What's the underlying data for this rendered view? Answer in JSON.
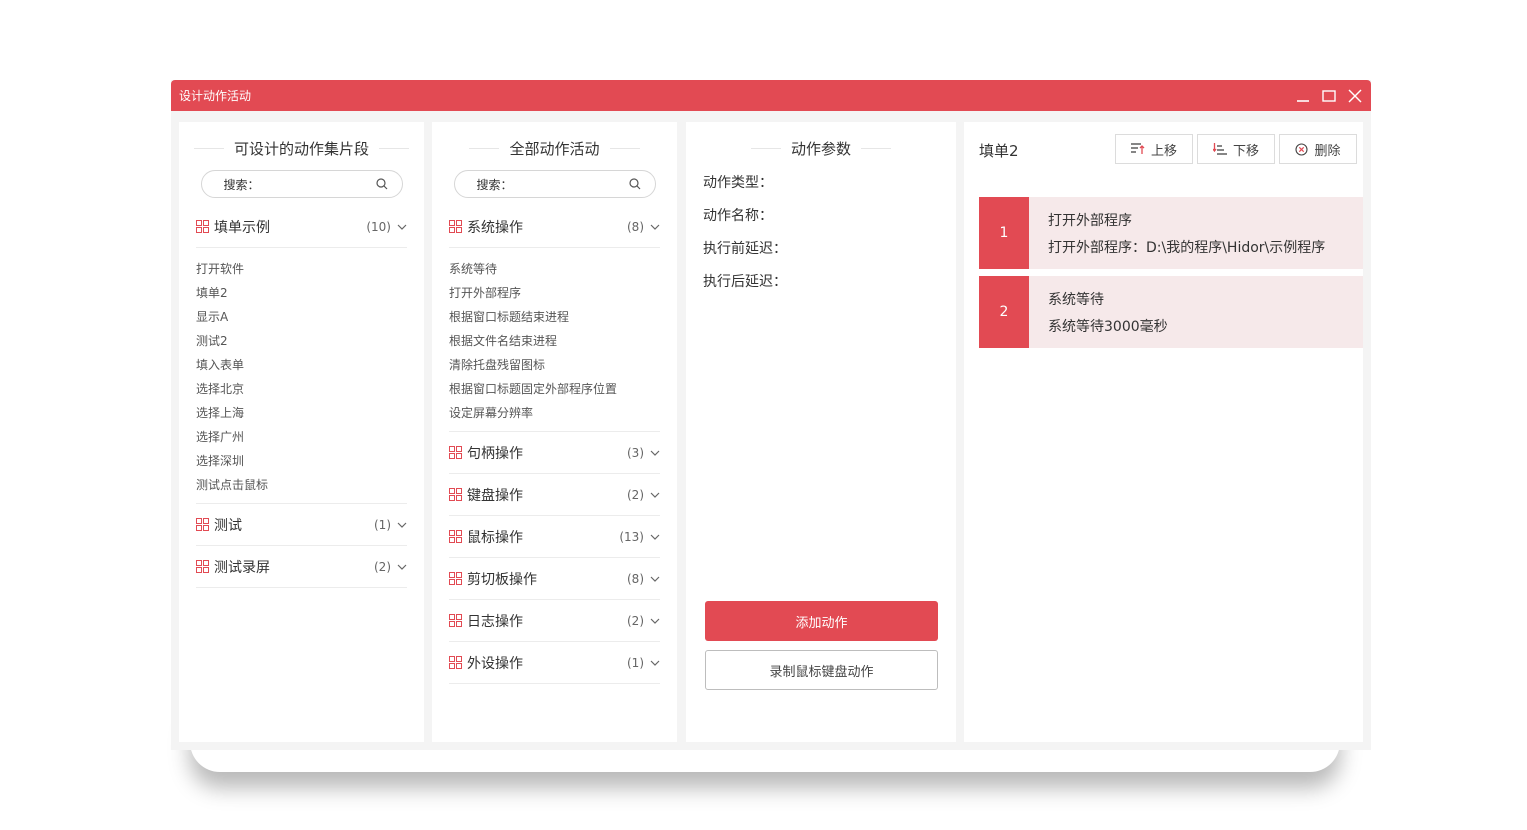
{
  "window": {
    "title": "设计动作活动",
    "accent": "#e24a53"
  },
  "panel1": {
    "header": "可设计的动作集片段",
    "search_label": "搜索：",
    "groups": [
      {
        "name": "填单示例",
        "count": "(10)",
        "items": [
          "打开软件",
          "填单2",
          "显示A",
          "测试2",
          "填入表单",
          "选择北京",
          "选择上海",
          "选择广州",
          "选择深圳",
          "测试点击鼠标"
        ]
      },
      {
        "name": "测试",
        "count": "(1)"
      },
      {
        "name": "测试录屏",
        "count": "(2)"
      }
    ]
  },
  "panel2": {
    "header": "全部动作活动",
    "search_label": "搜索：",
    "groups": [
      {
        "name": "系统操作",
        "count": "(8)",
        "items": [
          "系统等待",
          "打开外部程序",
          "根据窗口标题结束进程",
          "根据文件名结束进程",
          "清除托盘残留图标",
          "根据窗口标题固定外部程序位置",
          "设定屏幕分辨率"
        ]
      },
      {
        "name": "句柄操作",
        "count": "(3)"
      },
      {
        "name": "键盘操作",
        "count": "(2)"
      },
      {
        "name": "鼠标操作",
        "count": "(13)"
      },
      {
        "name": "剪切板操作",
        "count": "(8)"
      },
      {
        "name": "日志操作",
        "count": "(2)"
      },
      {
        "name": "外设操作",
        "count": "(1)"
      }
    ]
  },
  "panel3": {
    "header": "动作参数",
    "params": [
      "动作类型：",
      "动作名称：",
      "执行前延迟：",
      "执行后延迟："
    ],
    "add_button": "添加动作",
    "record_button": "录制鼠标键盘动作"
  },
  "panel4": {
    "title": "填单2",
    "buttons": {
      "up": "上移",
      "down": "下移",
      "delete": "删除"
    },
    "steps": [
      {
        "num": "1",
        "name": "打开外部程序",
        "detail": "打开外部程序：D:\\我的程序\\Hidor\\示例程序"
      },
      {
        "num": "2",
        "name": "系统等待",
        "detail": "系统等待3000毫秒"
      }
    ]
  }
}
